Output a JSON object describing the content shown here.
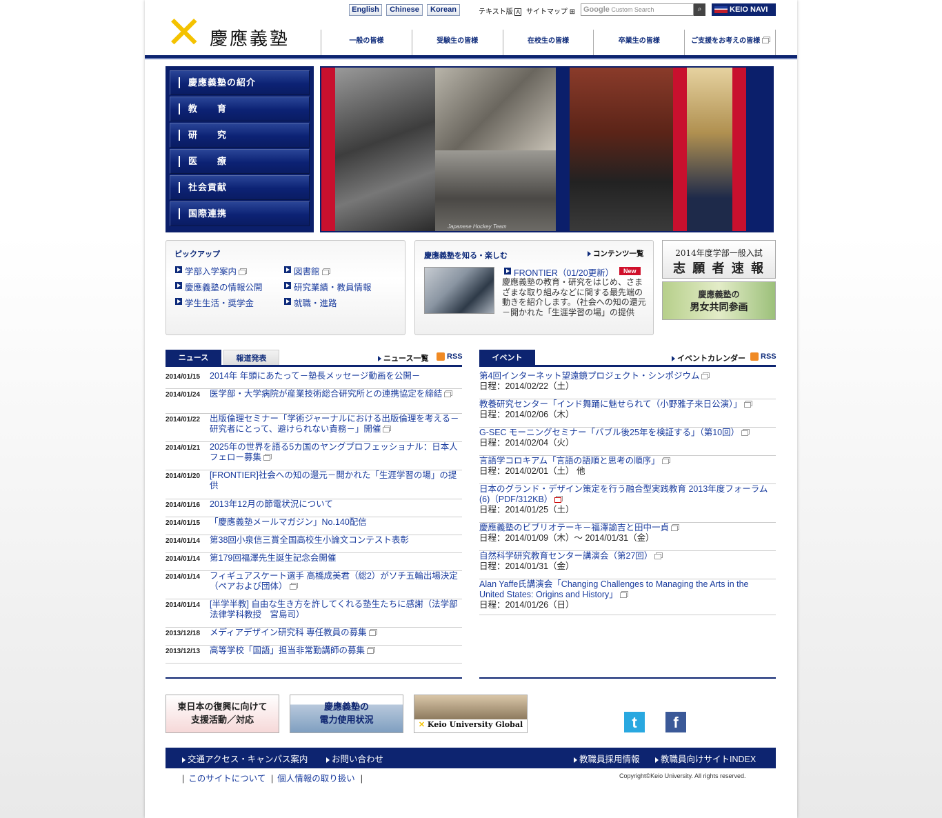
{
  "header": {
    "lang": [
      "English",
      "Chinese",
      "Korean"
    ],
    "text_ver": "テキスト版",
    "text_ver_badge": "A",
    "sitemap": "サイトマップ",
    "search_placeholder": "Custom Search",
    "search_brand": "Google",
    "keio_navi": "KEIO NAVI",
    "logo_mark": "✕",
    "logo_name": "慶應義塾",
    "nav": [
      "一般の皆様",
      "受験生の皆様",
      "在校生の皆様",
      "卒業生の皆様",
      "ご支援をお考えの皆様"
    ]
  },
  "main_menu": [
    "慶應義塾の紹介",
    "教　　育",
    "研　　究",
    "医　　療",
    "社会貢献",
    "国際連携"
  ],
  "hero": {
    "caption": "Japanese Hockey Team"
  },
  "pickup": {
    "title": "ピックアップ",
    "links": [
      "学部入学案内",
      "図書館",
      "慶應義塾の情報公開",
      "研究業績・教員情報",
      "学生生活・奨学金",
      "就職・進路"
    ]
  },
  "frontier": {
    "title": "慶應義塾を知る・楽しむ",
    "contents_link": "コンテンツ一覧",
    "item_title": "FRONTIER（01/20更新）",
    "badge": "New",
    "desc": "慶應義塾の教育・研究をはじめ、さまざまな取り組みなどに関する最先端の動きを紹介します。（社会への知の還元－開かれた「生涯学習の場」の提供"
  },
  "banners": {
    "b1_top": "2014年度学部一般入試",
    "b1_main": "志 願 者 速 報",
    "b2_top": "慶應義塾の",
    "b2_main": "男女共同参画"
  },
  "news": {
    "tab_active": "ニュース",
    "tab_other": "報道発表",
    "list_link": "ニュース一覧",
    "rss": "RSS",
    "items": [
      {
        "date": "2014/01/15",
        "title": "2014年 年頭にあたって－塾長メッセージ動画を公開－"
      },
      {
        "date": "2014/01/24",
        "title": "医学部・大学病院が産業技術総合研究所との連携協定を締結"
      },
      {
        "date": "2014/01/22",
        "title": "出版倫理セミナー「学術ジャーナルにおける出版倫理を考える－研究者にとって、避けられない責務－」開催"
      },
      {
        "date": "2014/01/21",
        "title": "2025年の世界を語る5カ国のヤングプロフェッショナル：日本人フェロー募集"
      },
      {
        "date": "2014/01/20",
        "title": "[FRONTIER]社会への知の還元－開かれた「生涯学習の場」の提供"
      },
      {
        "date": "2014/01/16",
        "title": "2013年12月の節電状況について"
      },
      {
        "date": "2014/01/15",
        "title": "「慶應義塾メールマガジン」No.140配信"
      },
      {
        "date": "2014/01/14",
        "title": "第38回小泉信三賞全国高校生小論文コンテスト表彰"
      },
      {
        "date": "2014/01/14",
        "title": "第179回福澤先生誕生記念会開催"
      },
      {
        "date": "2014/01/14",
        "title": "フィギュアスケート選手 高橋成美君（総2）がソチ五輪出場決定（ペアおよび団体）"
      },
      {
        "date": "2014/01/14",
        "title": "[半学半教] 自由な生き方を許してくれる塾生たちに感謝（法学部法律学科教授　宮島司）"
      },
      {
        "date": "2013/12/18",
        "title": "メディアデザイン研究科 専任教員の募集"
      },
      {
        "date": "2013/12/13",
        "title": "高等学校「国語」担当非常勤講師の募集"
      }
    ]
  },
  "events": {
    "tab_active": "イベント",
    "calendar_link": "イベントカレンダー",
    "rss": "RSS",
    "items": [
      {
        "title": "第4回インターネット望遠鏡プロジェクト・シンポジウム",
        "date": "日程：2014/02/22（土）"
      },
      {
        "title": "教養研究センター「インド舞踊に魅せられて（小野雅子来日公演）」",
        "date": "日程：2014/02/06（木）"
      },
      {
        "title": "G-SEC モーニングセミナー「バブル後25年を検証する」（第10回）",
        "date": "日程：2014/02/04（火）"
      },
      {
        "title": "言語学コロキアム「言語の語順と思考の順序」",
        "date": "日程：2014/02/01（土） 他"
      },
      {
        "title": "日本のグランド・デザイン策定を行う融合型実践教育 2013年度フォーラム(6)（PDF/312KB）",
        "date": "日程：2014/01/25（土）"
      },
      {
        "title": "慶應義塾のビブリオテーキ－福澤諭吉と田中一貞",
        "date": "日程：2014/01/09（木）～ 2014/01/31（金）"
      },
      {
        "title": "自然科学研究教育センター講演会（第27回）",
        "date": "日程：2014/01/31（金）"
      },
      {
        "title": "Alan Yaffe氏講演会「Changing Challenges to Managing the Arts in the United States: Origins and History」",
        "date": "日程：2014/01/26（日）"
      }
    ]
  },
  "footer": {
    "banner1": "東日本の復興に向けて\n支援活動／対応",
    "banner2": "慶應義塾の\n電力使用状況",
    "banner3": "Keio University Global",
    "twitter_glyph": "t",
    "facebook_glyph": "f",
    "links_left": [
      "交通アクセス・キャンパス案内",
      "お問い合わせ"
    ],
    "links_right": [
      "教職員採用情報",
      "教職員向けサイトINDEX"
    ],
    "sub_links": [
      "このサイトについて",
      "個人情報の取り扱い"
    ],
    "copyright": "Copyright©Keio University. All rights reserved."
  },
  "colors": {
    "navy": "#0d2470",
    "link": "#1a3c9e",
    "logo_yellow": "#f4c200",
    "hero_red": "#c8102e"
  }
}
